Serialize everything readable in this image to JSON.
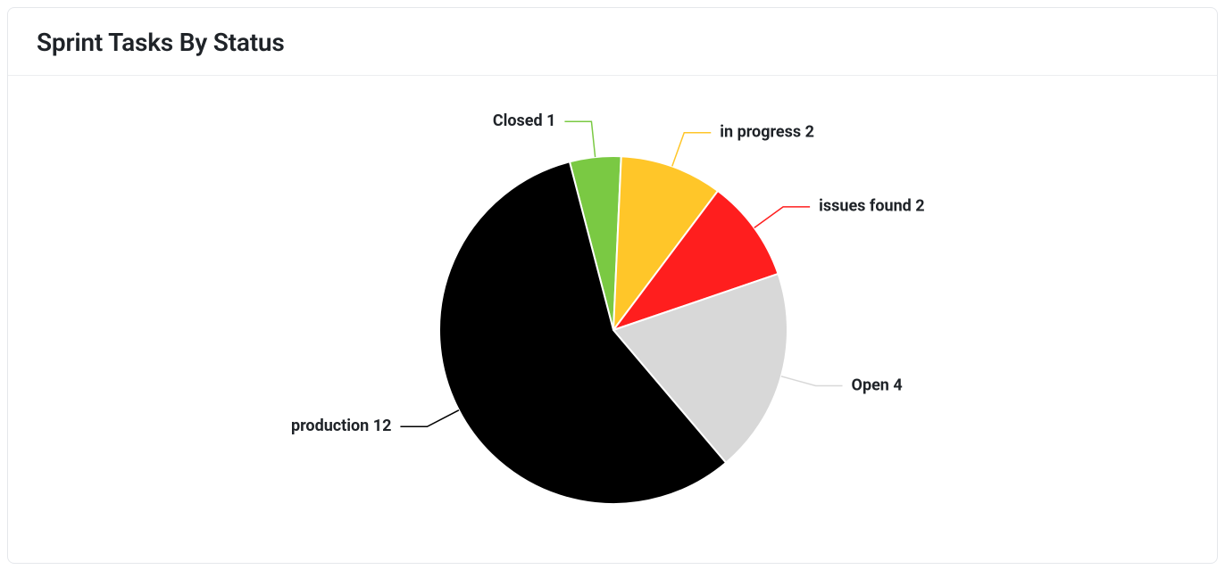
{
  "header": {
    "title": "Sprint Tasks By Status"
  },
  "chart_data": {
    "type": "pie",
    "title": "Sprint Tasks By Status",
    "series": [
      {
        "name": "Closed",
        "value": 1,
        "color": "#7AC943"
      },
      {
        "name": "in progress",
        "value": 2,
        "color": "#FFC629"
      },
      {
        "name": "issues found",
        "value": 2,
        "color": "#FF1E1E"
      },
      {
        "name": "Open",
        "value": 4,
        "color": "#D8D8D8"
      },
      {
        "name": "production",
        "value": 12,
        "color": "#000000"
      }
    ],
    "label_format": "{name} {value}"
  }
}
